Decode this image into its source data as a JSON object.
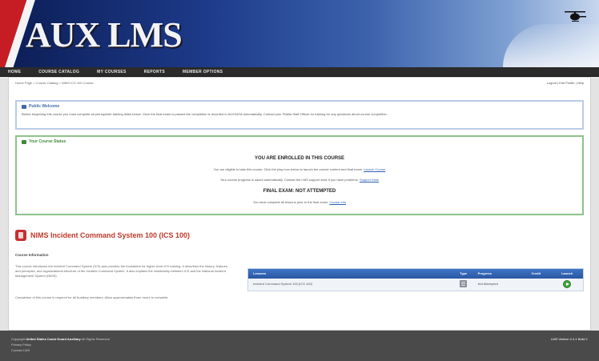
{
  "header": {
    "logo": "AUX LMS",
    "tagline": ""
  },
  "nav": {
    "items": [
      {
        "label": "HOME",
        "name": "nav-home"
      },
      {
        "label": "COURSE CATALOG",
        "name": "nav-course-catalog"
      },
      {
        "label": "MY COURSES",
        "name": "nav-my-courses"
      },
      {
        "label": "REPORTS",
        "name": "nav-reports"
      },
      {
        "label": "MEMBER OPTIONS",
        "name": "nav-member-options"
      }
    ]
  },
  "breadcrumb": "Home Page > Course Catalog > NIMS ICS 100 Course",
  "welcome": "Logout | Edit Profile | Help",
  "notice": {
    "title": "Public Welcome",
    "text": "Before beginning this course you must complete all prerequisite training listed below. Once the final exam is passed the completion is recorded in AUXDATA automatically. Contact your Flotilla Staff Officer for training for any questions about course completion."
  },
  "status": {
    "title": "Your Course Status",
    "line1": "YOU ARE ENROLLED IN THIS COURSE",
    "line2": "You are eligible to take this course. Click the play icon below to launch the course content and final exam.",
    "line3": "Your course progress is saved automatically. Contact the LMS support desk if you have problems.",
    "line4": "FINAL EXAM: NOT ATTEMPTED",
    "line5": "You must complete all lessons prior to the final exam.",
    "link1": "Launch Course",
    "link2": "Support Desk",
    "link3": "Course Info"
  },
  "course": {
    "title": "NIMS Incident Command System 100 (ICS 100)",
    "info_title": "Course Information",
    "info_text": "This course introduces the Incident Command System (ICS) and provides the foundation for higher level ICS training. It describes the history, features and principles, and organizational structure of the Incident Command System. It also explains the relationship between ICS and the National Incident Management System (NIMS).",
    "info_text2": "Completion of this course is required for all Auxiliary members. Allow approximately three hours to complete."
  },
  "table": {
    "headers": [
      "Lessons",
      "Type",
      "Progress",
      "Credit",
      "Launch"
    ],
    "rows": [
      {
        "name": "Incident Command System 100 (ICS 100)",
        "progress": "Not Attempted",
        "credit": ""
      }
    ]
  },
  "footer": {
    "line1_a": "Copyright",
    "line1_b": "United States Coast Guard Auxiliary",
    "line1_c": "All Rights Reserved",
    "line2": "Privacy Policy",
    "line3": "Contact LMS",
    "right": "LMS Version 2.4.1 Build 1",
    "colors": {
      "header": "#1d3b8a",
      "nav": "#2b2b2b",
      "footer": "#4a4a4a",
      "accent": "#c0392b",
      "table_head": "#2a58a3",
      "green_border": "#8ec28a",
      "blue_border": "#b9cce6"
    }
  }
}
